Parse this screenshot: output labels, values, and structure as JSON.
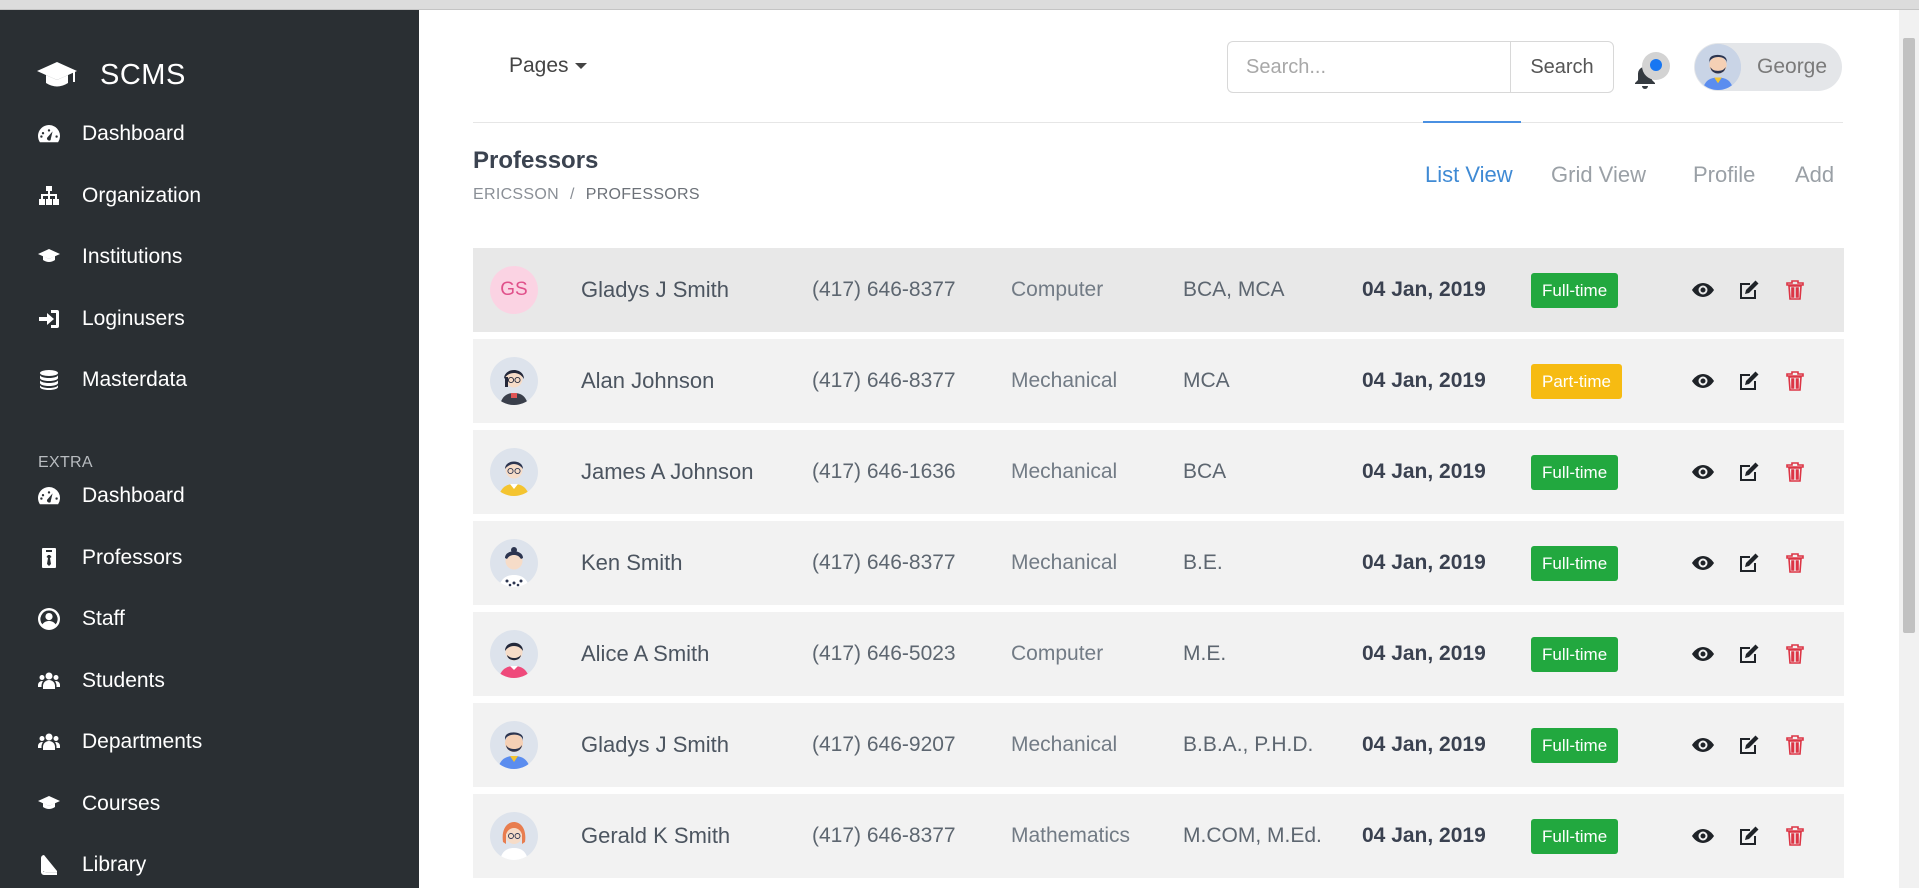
{
  "brand": "SCMS",
  "sidebar": {
    "items": [
      {
        "label": "Dashboard",
        "icon": "tachometer-icon"
      },
      {
        "label": "Organization",
        "icon": "sitemap-icon"
      },
      {
        "label": "Institutions",
        "icon": "graduation-cap-icon"
      },
      {
        "label": "Loginusers",
        "icon": "sign-in-icon"
      },
      {
        "label": "Masterdata",
        "icon": "database-icon"
      }
    ],
    "extra_label": "EXTRA",
    "extra_items": [
      {
        "label": "Dashboard",
        "icon": "tachometer-icon"
      },
      {
        "label": "Professors",
        "icon": "id-badge-icon"
      },
      {
        "label": "Staff",
        "icon": "user-circle-icon"
      },
      {
        "label": "Students",
        "icon": "users-icon"
      },
      {
        "label": "Departments",
        "icon": "users-icon"
      },
      {
        "label": "Courses",
        "icon": "graduation-cap-icon"
      },
      {
        "label": "Library",
        "icon": "book-icon"
      }
    ]
  },
  "header": {
    "pages_label": "Pages",
    "search_placeholder": "Search...",
    "search_button": "Search",
    "user_name": "George"
  },
  "page": {
    "title": "Professors",
    "breadcrumb": [
      "ERICSSON",
      "PROFESSORS"
    ],
    "breadcrumb_sep": "/",
    "tabs": [
      "List View",
      "Grid View",
      "Profile",
      "Add"
    ],
    "active_tab": "List View"
  },
  "professors": [
    {
      "initials": "GS",
      "name": "Gladys J Smith",
      "phone": "(417) 646-8377",
      "department": "Computer",
      "qualification": "BCA, MCA",
      "joined": "04 Jan, 2019",
      "type": "Full-time"
    },
    {
      "name": "Alan Johnson",
      "phone": "(417) 646-8377",
      "department": "Mechanical",
      "qualification": "MCA",
      "joined": "04 Jan, 2019",
      "type": "Part-time"
    },
    {
      "name": "James A Johnson",
      "phone": "(417) 646-1636",
      "department": "Mechanical",
      "qualification": "BCA",
      "joined": "04 Jan, 2019",
      "type": "Full-time"
    },
    {
      "name": "Ken Smith",
      "phone": "(417) 646-8377",
      "department": "Mechanical",
      "qualification": "B.E.",
      "joined": "04 Jan, 2019",
      "type": "Full-time"
    },
    {
      "name": "Alice A Smith",
      "phone": "(417) 646-5023",
      "department": "Computer",
      "qualification": "M.E.",
      "joined": "04 Jan, 2019",
      "type": "Full-time"
    },
    {
      "name": "Gladys J Smith",
      "phone": "(417) 646-9207",
      "department": "Mechanical",
      "qualification": "B.B.A., P.H.D.",
      "joined": "04 Jan, 2019",
      "type": "Full-time"
    },
    {
      "name": "Gerald K Smith",
      "phone": "(417) 646-8377",
      "department": "Mathematics",
      "qualification": "M.COM, M.Ed.",
      "joined": "04 Jan, 2019",
      "type": "Full-time"
    }
  ],
  "colors": {
    "sidebar_bg": "#2a2f33",
    "accent_blue": "#3f8ad4",
    "badge_full": "#22a83f",
    "badge_part": "#f6bb12",
    "delete_red": "#dc3545"
  }
}
